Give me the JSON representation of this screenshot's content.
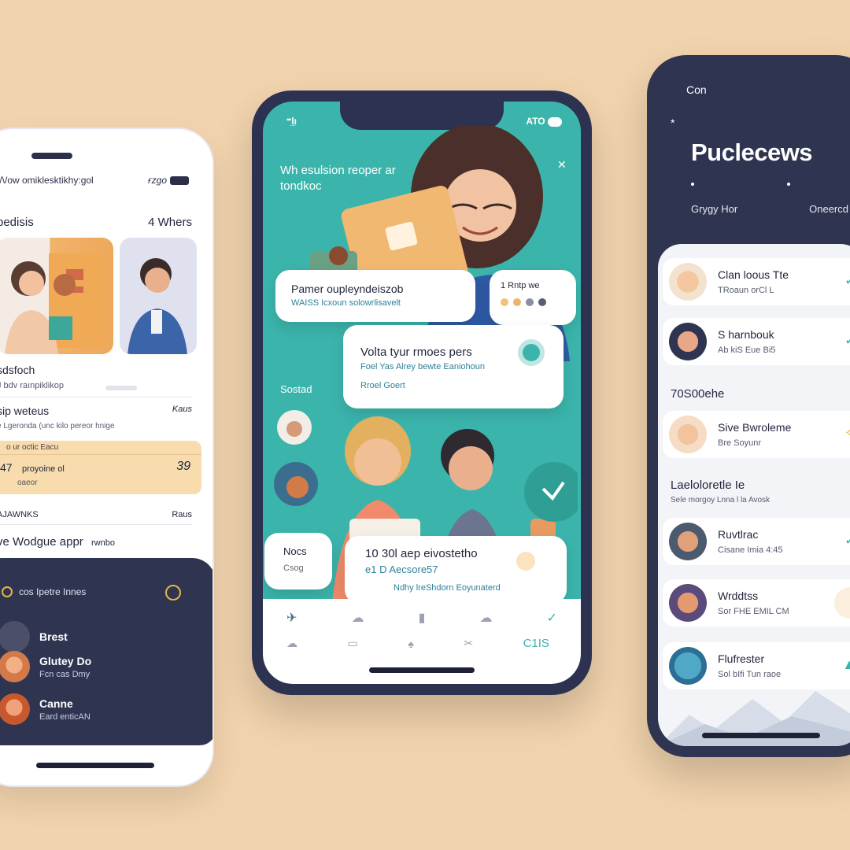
{
  "colors": {
    "background": "#f1d3ad",
    "teal": "#3bb5ac",
    "navy": "#2f3551",
    "peach": "#f8dcae"
  },
  "left": {
    "status_left": "\\/\\/ow omiklesktikhy:gol",
    "status_right": "ғzgo",
    "section_title": "pedisis",
    "section_count": "4 Whers",
    "item1_title": "sdsfoch",
    "item1_sub": "J bdv raınpiklikop",
    "item2_title": "sip weteus",
    "item2_right": "Kaus",
    "item2_sub": "e Lgeronda (unc kilo pereor hnige",
    "pay_label": "o ur octic Eacu",
    "pay_amount_left": "47",
    "pay_desc": "proyoine ol",
    "pay_sub": "oaeor",
    "pay_amount_right": "39",
    "row3_left": "AJAWNKS",
    "row3_right": "Raus",
    "app_title": "ve Wodgue appr",
    "app_suffix": "rwnbo",
    "dark_header": "cos Ipetre Innes",
    "contacts": [
      {
        "name": "Brest",
        "detail": ""
      },
      {
        "name": "Glutey Do",
        "detail": "Fcn cas Dmy"
      },
      {
        "name": "Canne",
        "detail": "Eard enticAN"
      }
    ]
  },
  "center": {
    "status_left": "⁼l̲ı",
    "status_right": "ATO",
    "heading": "Wh esulsion reoper ar tondkoc",
    "bubble1_title": "Pamer oupleyndeiszob",
    "bubble1_sub": "WAISS Icxoun solowrlisavelt",
    "bubble2_title": "1 Rntp we",
    "bubble3_title": "Volta tyur rmoes pers",
    "bubble3_sub": "Foel Yas Alrey bewte Eaniohoun",
    "bubble3_foot": "Rroel Goert",
    "side_label": "Sostad",
    "bubble4_title": "Nocs",
    "bubble4_sub": "Csog",
    "bubble5_title": "10 30l aep eivostetho",
    "bubble5_sub": "e1 D Aecsore57",
    "bubble5_foot": "Ndhy lreShdorn Eoyunaterd",
    "bottom_label": "C1IS"
  },
  "right": {
    "top_label": "Con",
    "star": "*",
    "title": "Puclecews",
    "tab1": "Grygy Hor",
    "tab2": "Oneercd",
    "items": [
      {
        "name": "Clan loous Tte",
        "sub": "TRoaun orCl L"
      },
      {
        "name": "S harnbouk",
        "sub": "Ab kiS Eue Bi5"
      },
      {
        "name": "Sive Bwroleme",
        "sub": "Bre Soyunr"
      },
      {
        "name": "Ruvtlrac",
        "sub": "Cisane Imia 4:45"
      },
      {
        "name": "Wrddtss",
        "sub": "Sor FHE EMIL CM"
      },
      {
        "name": "Flufrester",
        "sub": "Sol bIfi Tun raoe"
      }
    ],
    "header1": "70S00ehe",
    "header2": "Laeloloretle Ie",
    "header2_sub": "Sele morgoy Lnna l la Avosk"
  }
}
